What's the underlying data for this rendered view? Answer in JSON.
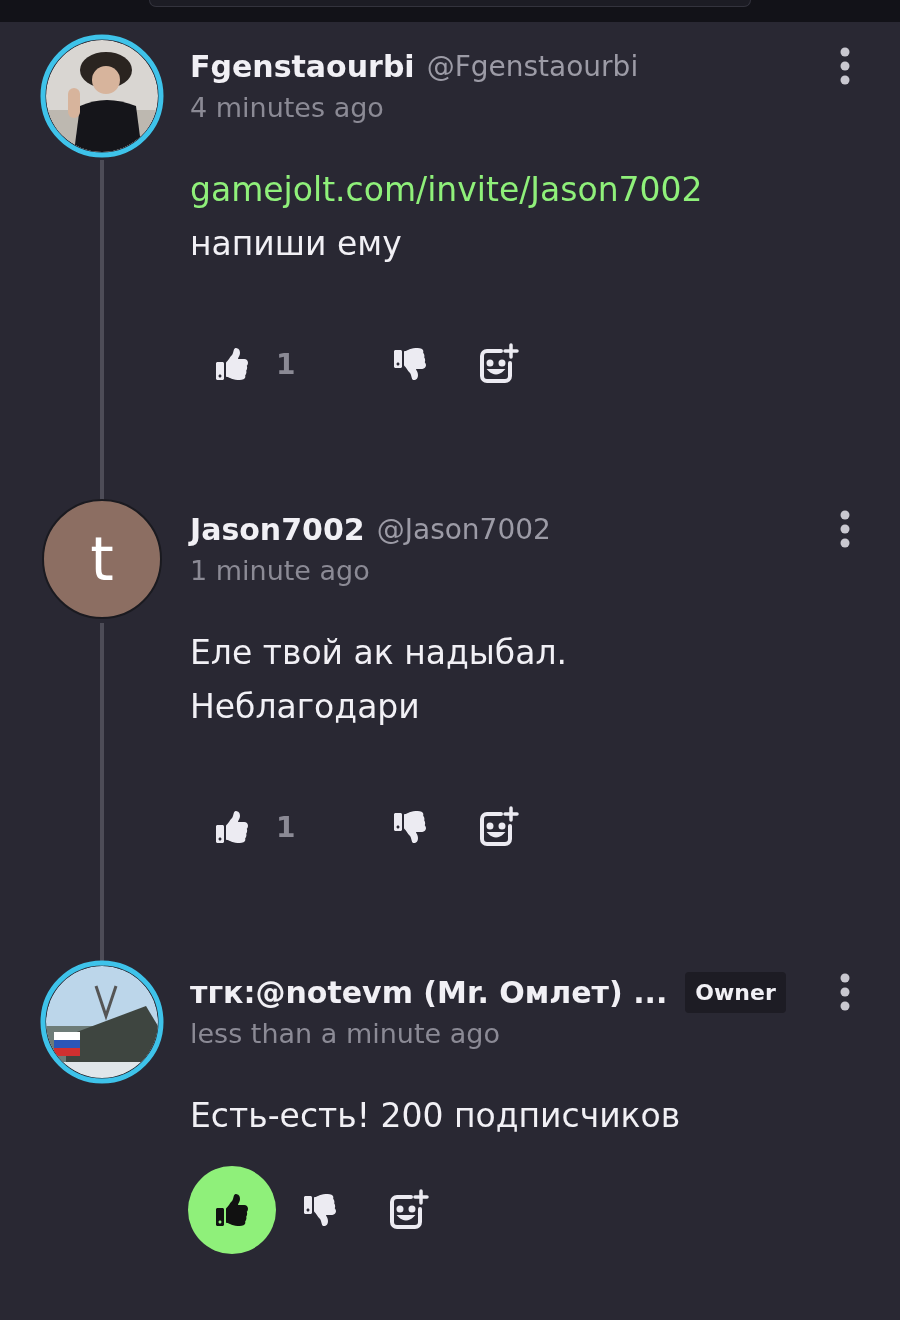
{
  "comments": [
    {
      "name": "Fgenstaourbi",
      "handle": "@Fgenstaourbi",
      "time": "4 minutes ago",
      "avatar": {
        "kind": "picture"
      },
      "liked": false,
      "likes": "1",
      "body": [
        {
          "kind": "link",
          "text": "gamejolt.com/invite/Jason7002"
        },
        {
          "kind": "text",
          "text": "напиши ему"
        }
      ]
    },
    {
      "name": "Jason7002",
      "handle": "@Jason7002",
      "time": "1 minute ago",
      "avatar": {
        "kind": "letter",
        "letter": "t",
        "color": "#8c6e62"
      },
      "liked": false,
      "likes": "1",
      "body": [
        {
          "kind": "text",
          "text": "Еле твой ак надыбал."
        },
        {
          "kind": "text",
          "text": "Неблагодари"
        }
      ]
    },
    {
      "name": "тгк:@notevm (Mr. Омлет) ...",
      "time": "less than a minute ago",
      "avatar": {
        "kind": "picture"
      },
      "badge": "Owner",
      "liked": true,
      "body": [
        {
          "kind": "text",
          "text": "Есть-есть! 200 подписчиков"
        }
      ]
    }
  ]
}
